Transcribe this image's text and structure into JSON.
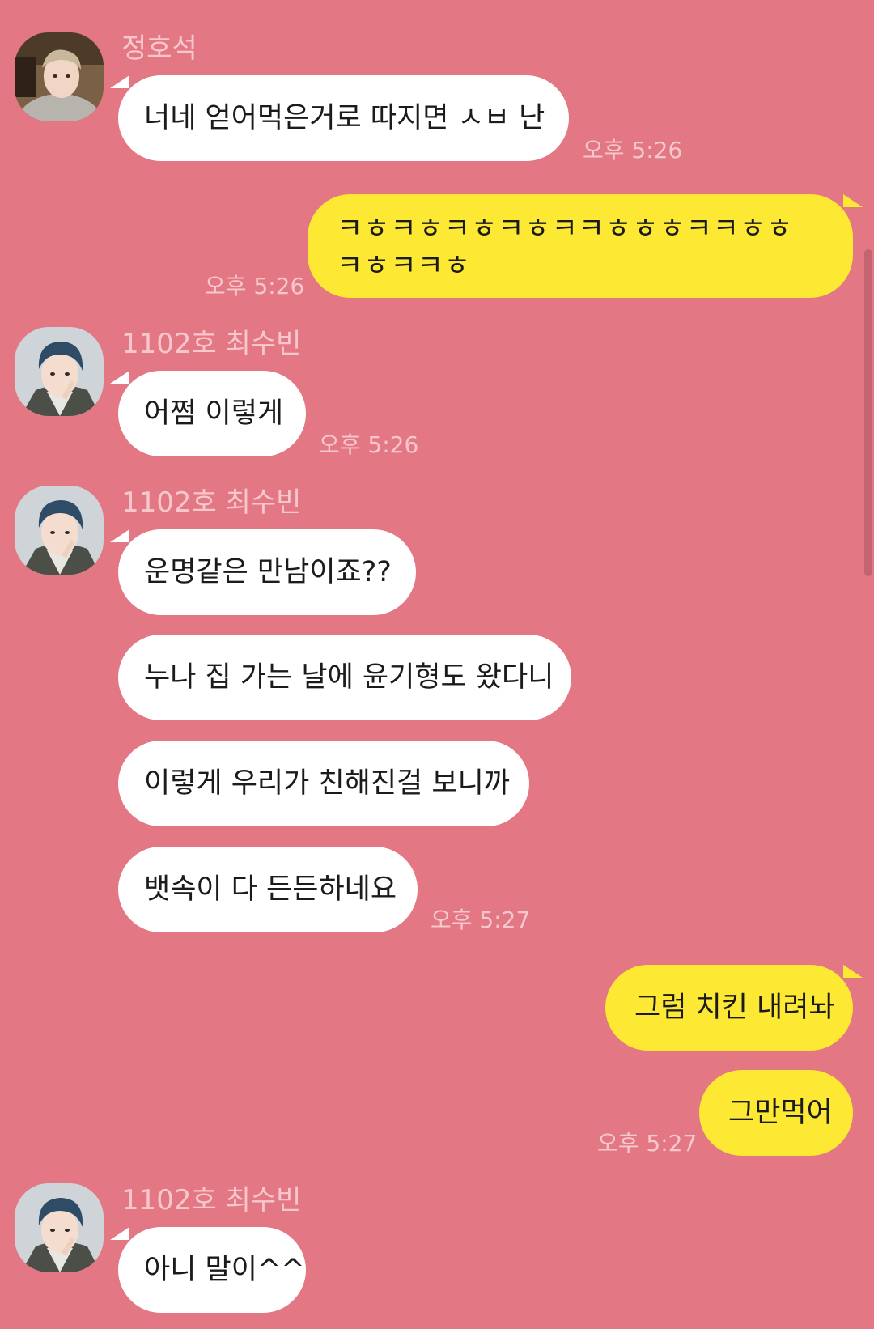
{
  "colors": {
    "background": "#e37783",
    "incoming_bubble": "#ffffff",
    "outgoing_bubble": "#fde833",
    "meta_text": "#f6c8cd"
  },
  "messages": [
    {
      "sender": "정호석",
      "text": "너네 얻어먹은거로 따지면 ㅅㅂ 난",
      "time": "오후 5:26"
    },
    {
      "text_line1": "ㅋㅎㅋㅎㅋㅎㅋㅎㅋㅋㅎㅎㅎㅋㅋㅎㅎ",
      "text_line2": "ㅋㅎㅋㅋㅎ",
      "time": "오후 5:26"
    },
    {
      "sender": "1102호 최수빈",
      "text": "어쩜 이렇게",
      "time": "오후 5:26"
    },
    {
      "sender": "1102호 최수빈",
      "texts": [
        "운명같은 만남이죠??",
        "누나 집 가는 날에 윤기형도 왔다니",
        "이렇게 우리가 친해진걸 보니까",
        "뱃속이 다 든든하네요"
      ],
      "time": "오후 5:27"
    },
    {
      "texts": [
        "그럼 치킨 내려놔",
        "그만먹어"
      ],
      "time": "오후 5:27"
    },
    {
      "sender": "1102호 최수빈",
      "text": "아니 말이^^"
    }
  ],
  "avatars": [
    {
      "name": "avatar-hoseok-icon"
    },
    {
      "name": "avatar-soobin-icon"
    }
  ]
}
